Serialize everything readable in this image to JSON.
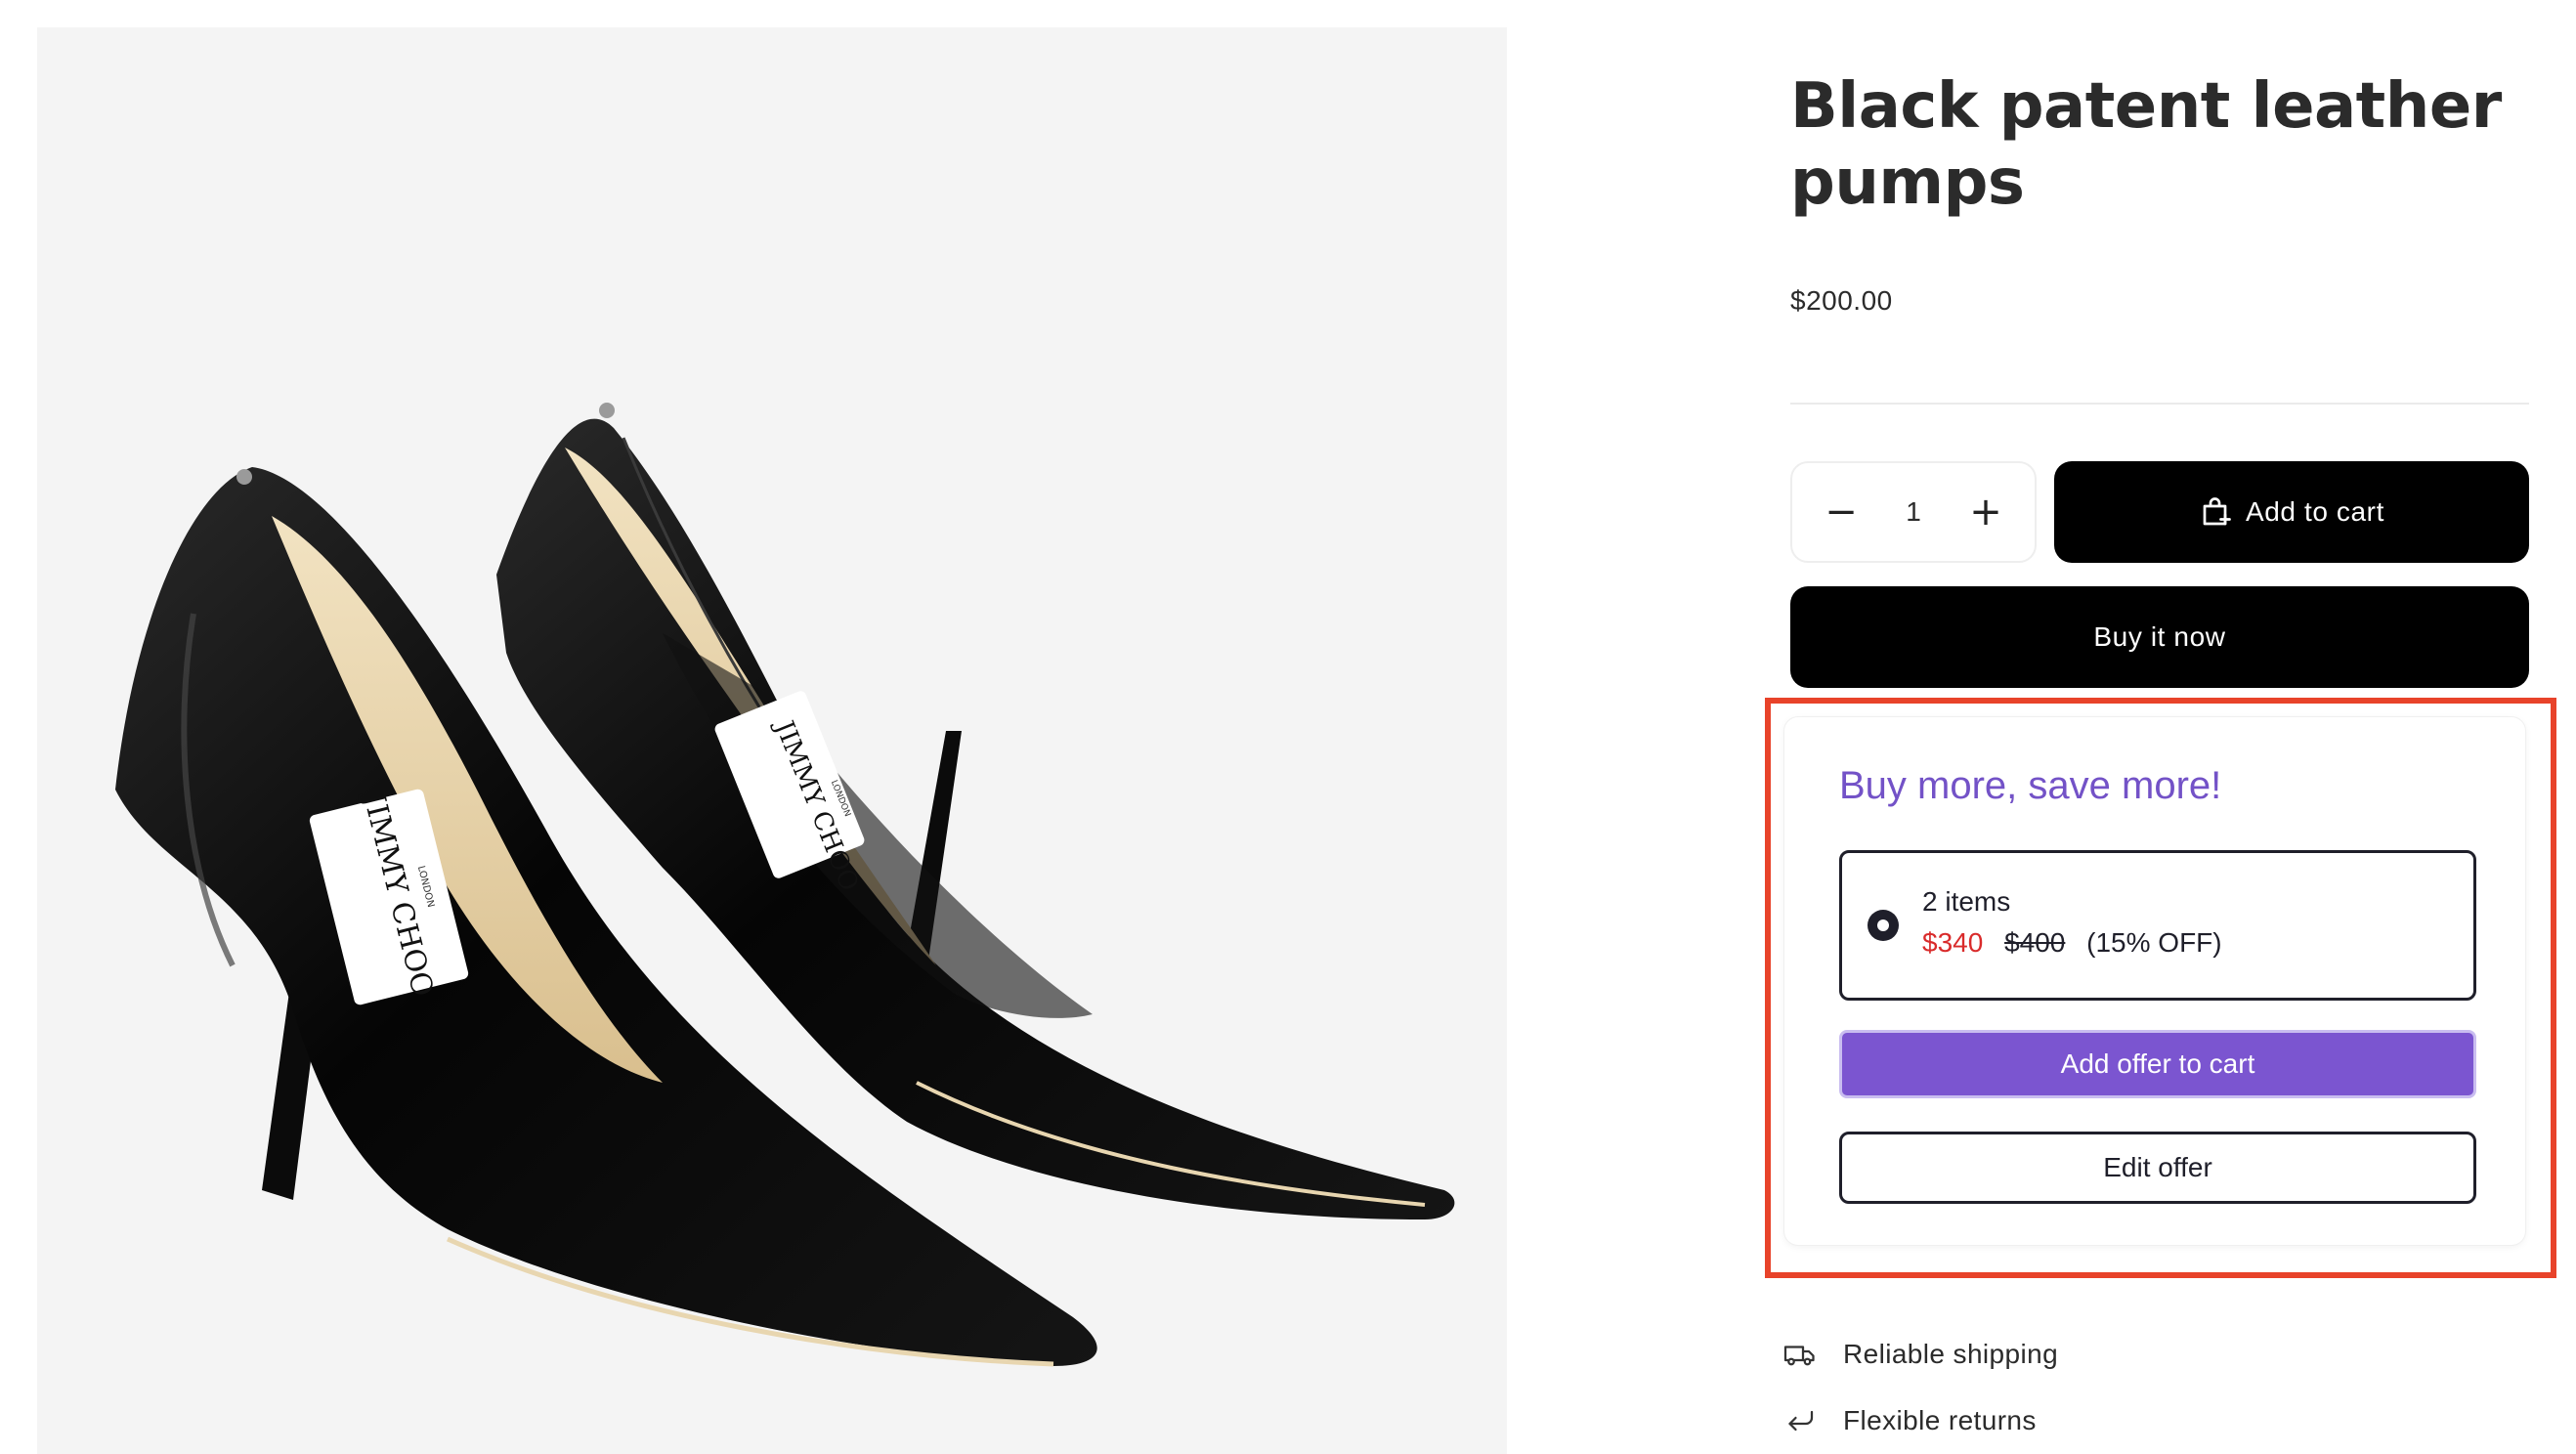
{
  "product": {
    "title": "Black patent leather pumps",
    "price": "$200.00",
    "image_alt": "Black patent leather pumps",
    "image_brand_text": "JIMMY CHOO",
    "image_brand_subtext": "LONDON"
  },
  "purchase": {
    "quantity": "1",
    "minus_symbol": "−",
    "plus_symbol": "+",
    "add_to_cart_label": "Add to cart",
    "buy_now_label": "Buy it now"
  },
  "offer": {
    "heading": "Buy more, save more!",
    "option": {
      "selected": true,
      "title": "2 items",
      "sale_price": "$340",
      "original_price": "$400",
      "discount": "(15% OFF)"
    },
    "add_offer_label": "Add offer to cart",
    "edit_offer_label": "Edit offer"
  },
  "perks": [
    {
      "label": "Reliable shipping",
      "icon": "truck-icon"
    },
    {
      "label": "Flexible returns",
      "icon": "return-arrow-icon"
    }
  ],
  "colors": {
    "accent_purple": "#7b55d0",
    "heading_purple": "#7352c7",
    "sale_red": "#d92b2b",
    "highlight_frame": "#e8432a",
    "button_black": "#000000"
  }
}
